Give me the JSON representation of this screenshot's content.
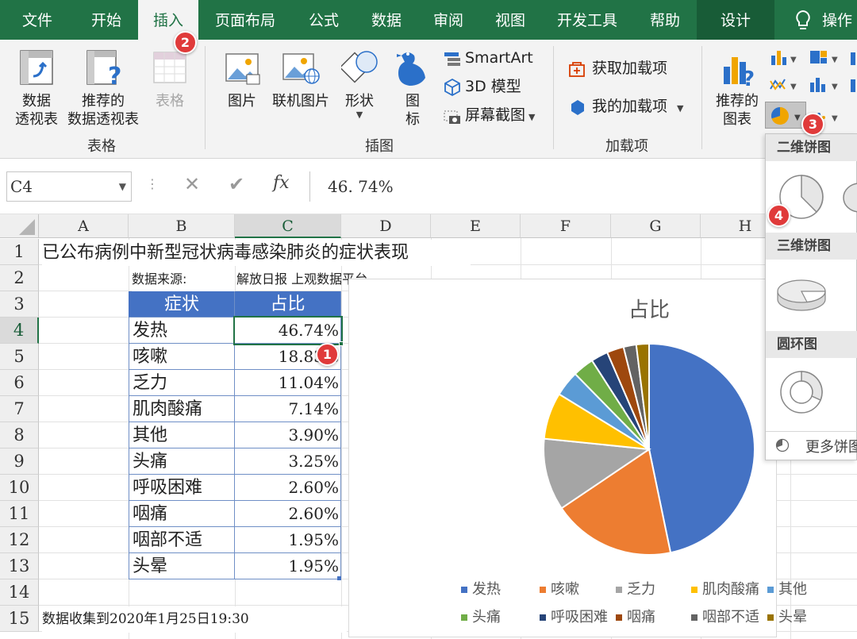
{
  "tabs": [
    {
      "label": "文件"
    },
    {
      "label": "开始"
    },
    {
      "label": "插入"
    },
    {
      "label": "页面布局"
    },
    {
      "label": "公式"
    },
    {
      "label": "数据"
    },
    {
      "label": "审阅"
    },
    {
      "label": "视图"
    },
    {
      "label": "开发工具"
    },
    {
      "label": "帮助"
    },
    {
      "label": "设计"
    },
    {
      "label": "操作"
    }
  ],
  "ribbon": {
    "pivot_l1": "数据",
    "pivot_l2": "透视表",
    "rec_pivot_l1": "推荐的",
    "rec_pivot_l2": "数据透视表",
    "table": "表格",
    "group_tables": "表格",
    "picture": "图片",
    "online_picture": "联机图片",
    "shapes": "形状",
    "icons_l1": "图",
    "icons_l2": "标",
    "smartart": "SmartArt",
    "model3d": "3D 模型",
    "screenshot": "屏幕截图",
    "group_illustrations": "插图",
    "get_addins": "获取加载项",
    "my_addins": "我的加载项",
    "group_addins": "加载项",
    "rec_chart_l1": "推荐的",
    "rec_chart_l2": "图表"
  },
  "formula_bar": {
    "name_box": "C4",
    "fx": "fx",
    "value": "46. 74%"
  },
  "columns": [
    "A",
    "B",
    "C",
    "D",
    "E",
    "F",
    "G",
    "H"
  ],
  "rows": [
    "1",
    "2",
    "3",
    "4",
    "5",
    "6",
    "7",
    "8",
    "9",
    "10",
    "11",
    "12",
    "13",
    "14",
    "15"
  ],
  "sheet": {
    "title": "已公布病例中新型冠状病毒感染肺炎的症状表现",
    "source_label": "数据来源:",
    "source_value": "解放日报 上观数据平台",
    "footer": "数据收集到2020年1月25日19:30",
    "header_symptom": "症状",
    "header_ratio": "占比",
    "table_rows": [
      {
        "symptom": "发热",
        "ratio": "46.74%"
      },
      {
        "symptom": "咳嗽",
        "ratio": "18.83%"
      },
      {
        "symptom": "乏力",
        "ratio": "11.04%"
      },
      {
        "symptom": "肌肉酸痛",
        "ratio": "7.14%"
      },
      {
        "symptom": "其他",
        "ratio": "3.90%"
      },
      {
        "symptom": "头痛",
        "ratio": "3.25%"
      },
      {
        "symptom": "呼吸困难",
        "ratio": "2.60%"
      },
      {
        "symptom": "咽痛",
        "ratio": "2.60%"
      },
      {
        "symptom": "咽部不适",
        "ratio": "1.95%"
      },
      {
        "symptom": "头晕",
        "ratio": "1.95%"
      }
    ]
  },
  "pie_menu": {
    "header_2d": "二维饼图",
    "header_3d": "三维饼图",
    "header_donut": "圆环图",
    "more": "更多饼图"
  },
  "badges": [
    "1",
    "2",
    "3",
    "4"
  ],
  "colors": {
    "excel_green": "#217346",
    "table_header": "#4472c4"
  },
  "chart_data": {
    "type": "pie",
    "title": "占比",
    "categories": [
      "发热",
      "咳嗽",
      "乏力",
      "肌肉酸痛",
      "其他",
      "头痛",
      "呼吸困难",
      "咽痛",
      "咽部不适",
      "头晕"
    ],
    "values": [
      46.74,
      18.83,
      11.04,
      7.14,
      3.9,
      3.25,
      2.6,
      2.6,
      1.95,
      1.95
    ],
    "colors": [
      "#4472c4",
      "#ed7d31",
      "#a5a5a5",
      "#ffc000",
      "#5b9bd5",
      "#70ad47",
      "#264478",
      "#9e480e",
      "#636363",
      "#997300"
    ],
    "legend": "bottom"
  }
}
